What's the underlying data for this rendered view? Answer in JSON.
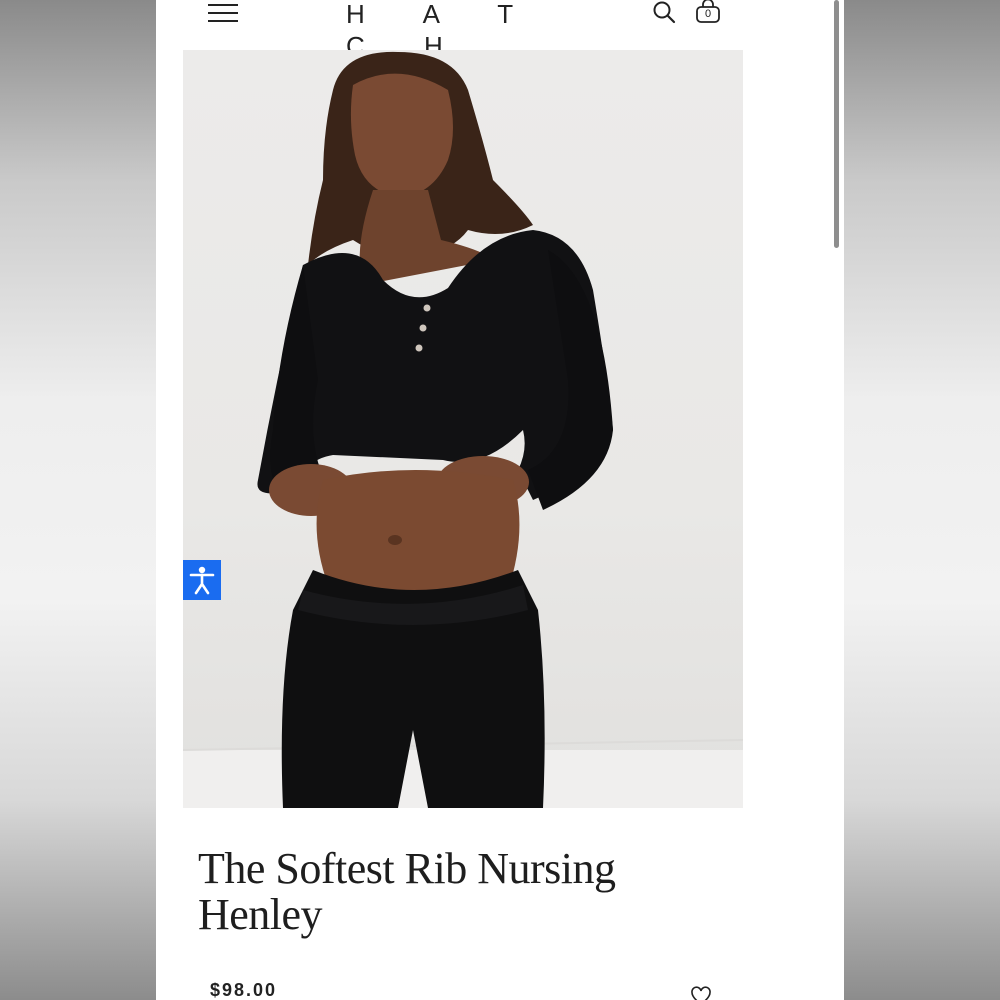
{
  "header": {
    "logo": "H A T C H",
    "cart_count": "0"
  },
  "product": {
    "title": "The Softest Rib Nursing Henley",
    "price": "$98.00"
  },
  "icons": {
    "menu": "hamburger-menu-icon",
    "search": "search-icon",
    "bag": "shopping-bag-icon",
    "accessibility": "accessibility-icon",
    "wishlist": "heart-icon"
  },
  "colors": {
    "accessibility_button": "#1a6cf0",
    "text": "#1e1e1e",
    "garment": "#0f0f10"
  }
}
